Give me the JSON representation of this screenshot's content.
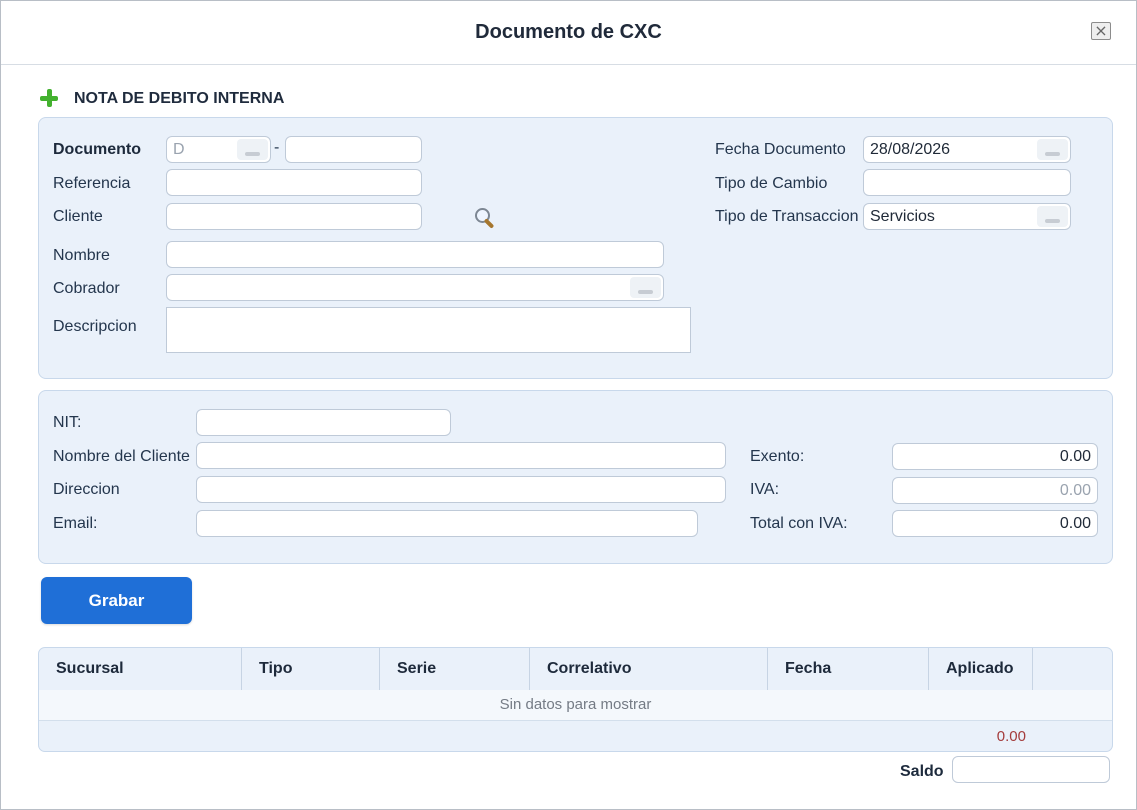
{
  "window": {
    "title": "Documento de CXC",
    "close_symbol": "×"
  },
  "section": {
    "title": "NOTA DE DEBITO INTERNA"
  },
  "document": {
    "labels": {
      "documento": "Documento",
      "referencia": "Referencia",
      "cliente": "Cliente",
      "nombre": "Nombre",
      "cobrador": "Cobrador",
      "descripcion": "Descripcion",
      "fecha_documento": "Fecha Documento",
      "tipo_cambio": "Tipo de Cambio",
      "tipo_transaccion": "Tipo de Transaccion"
    },
    "values": {
      "serie": "D",
      "dash": "-",
      "fecha_documento": "28/08/2026",
      "tipo_transaccion": "Servicios"
    }
  },
  "tax": {
    "labels": {
      "nit": "NIT:",
      "nombre_cliente": "Nombre del Cliente",
      "direccion": "Direccion",
      "email": "Email:",
      "exento": "Exento:",
      "iva": "IVA:",
      "total": "Total con IVA:"
    },
    "values": {
      "exento": "0.00",
      "iva": "0.00",
      "total": "0.00"
    }
  },
  "actions": {
    "save": "Grabar"
  },
  "table": {
    "columns": [
      "Sucursal",
      "Tipo",
      "Serie",
      "Correlativo",
      "Fecha",
      "Aplicado"
    ],
    "empty_text": "Sin datos para mostrar",
    "total": "0.00"
  },
  "footer": {
    "saldo": "Saldo"
  },
  "icons": {
    "add": "add-icon",
    "search": "search-icon",
    "dropdown": "dropdown-icon",
    "close": "close-icon"
  },
  "colors": {
    "accent": "#1f6fd7",
    "panel": "#eaf1fa",
    "success": "#43b12f",
    "negative": "#a43c3c"
  }
}
